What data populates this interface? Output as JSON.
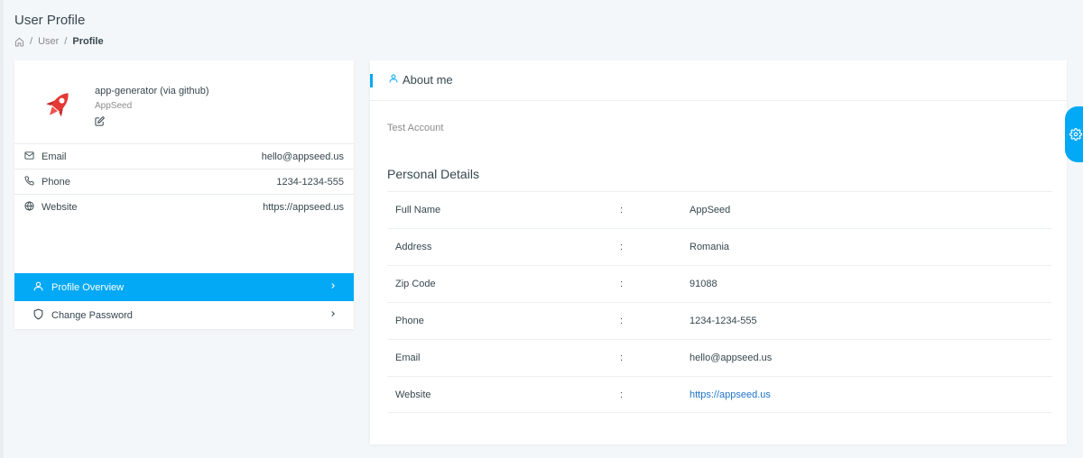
{
  "page": {
    "title": "User Profile",
    "breadcrumb": [
      "User",
      "Profile"
    ]
  },
  "profile": {
    "name": "app-generator (via github)",
    "company": "AppSeed",
    "avatar_icon": "rocket-icon"
  },
  "contact": [
    {
      "label": "Email",
      "value": "hello@appseed.us",
      "icon": "mail-icon"
    },
    {
      "label": "Phone",
      "value": "1234-1234-555",
      "icon": "phone-icon"
    },
    {
      "label": "Website",
      "value": "https://appseed.us",
      "icon": "globe-icon"
    }
  ],
  "nav": [
    {
      "label": "Profile Overview",
      "icon": "user-icon",
      "active": true
    },
    {
      "label": "Change Password",
      "icon": "shield-icon",
      "active": false
    }
  ],
  "about": {
    "header": "About me",
    "text": "Test Account",
    "section_title": "Personal Details",
    "separator": ":",
    "details": [
      {
        "label": "Full Name",
        "value": "AppSeed"
      },
      {
        "label": "Address",
        "value": "Romania"
      },
      {
        "label": "Zip Code",
        "value": "91088"
      },
      {
        "label": "Phone",
        "value": "1234-1234-555"
      },
      {
        "label": "Email",
        "value": "hello@appseed.us"
      },
      {
        "label": "Website",
        "value": "https://appseed.us"
      }
    ]
  },
  "colors": {
    "accent": "#04a9f5",
    "link": "#1f75cb",
    "background": "#f4f7fa"
  }
}
